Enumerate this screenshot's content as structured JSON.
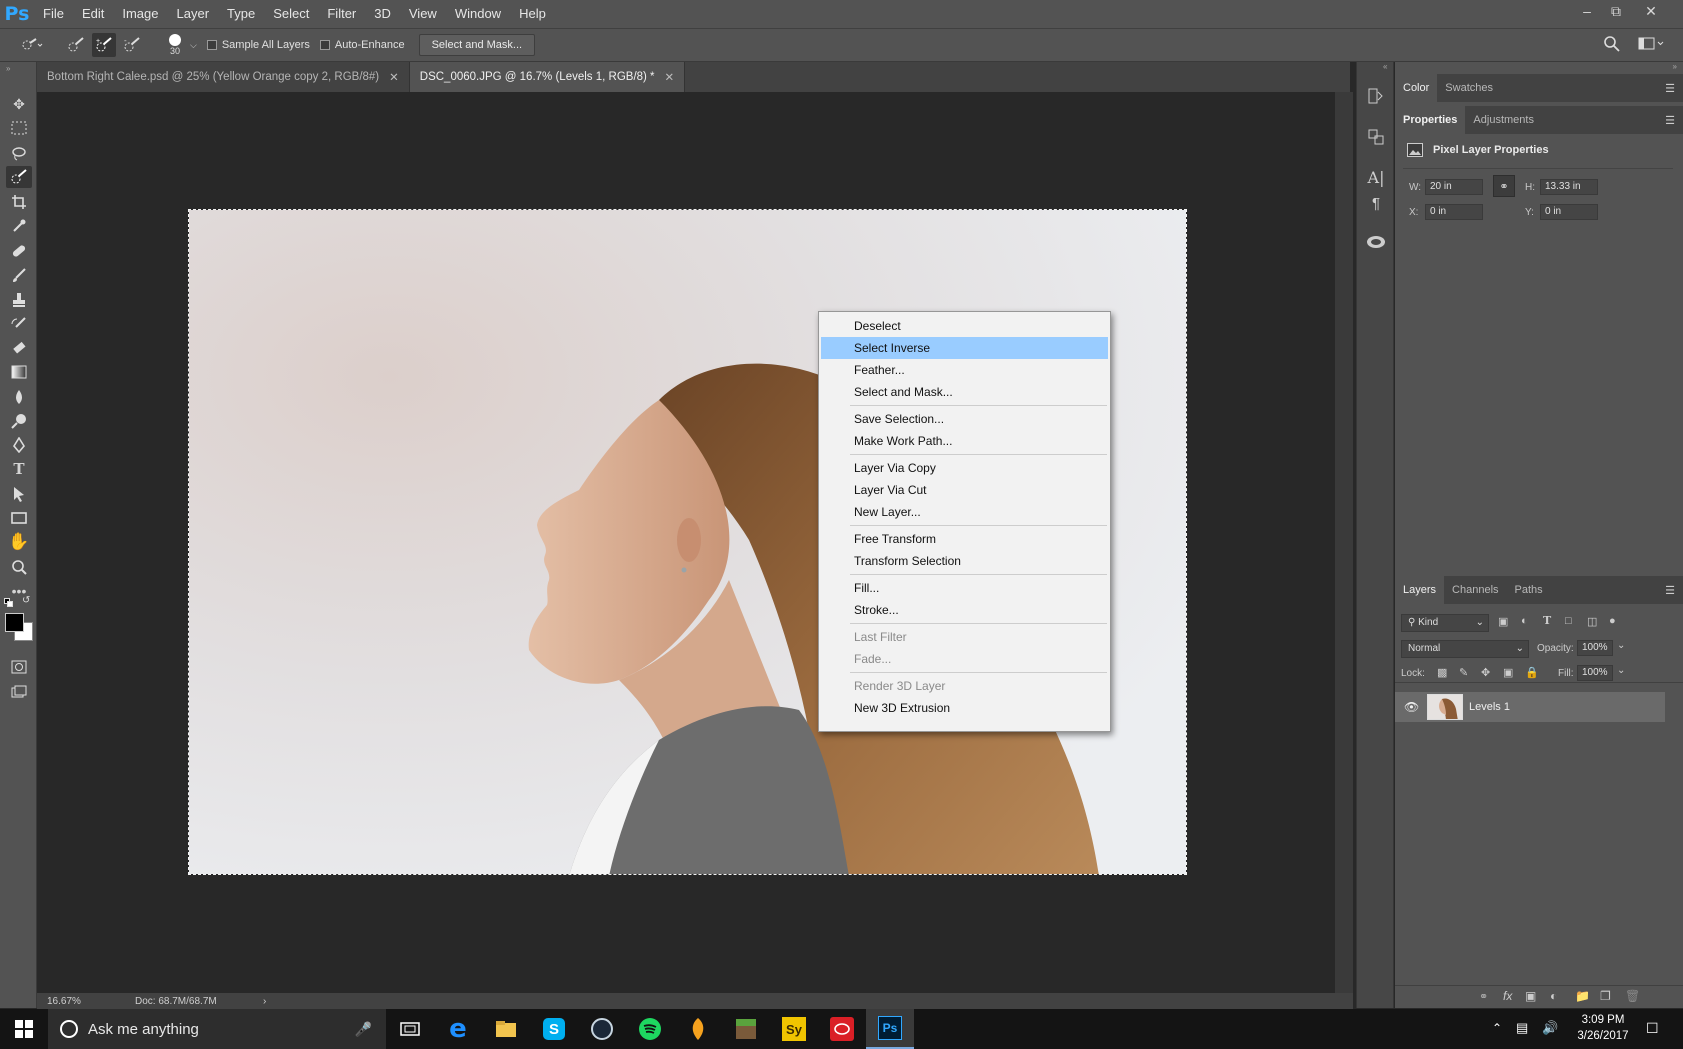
{
  "app": {
    "logo": "Ps"
  },
  "menubar": {
    "items": [
      "File",
      "Edit",
      "Image",
      "Layer",
      "Type",
      "Select",
      "Filter",
      "3D",
      "View",
      "Window",
      "Help"
    ]
  },
  "options": {
    "brush_size": "30",
    "sample_all_layers": "Sample All Layers",
    "auto_enhance": "Auto-Enhance",
    "select_and_mask": "Select and Mask..."
  },
  "tabs": [
    {
      "label": "Bottom Right Calee.psd @ 25% (Yellow Orange copy 2, RGB/8#)",
      "active": false
    },
    {
      "label": "DSC_0060.JPG @ 16.7% (Levels 1, RGB/8) *",
      "active": true
    }
  ],
  "context_menu": {
    "items": [
      {
        "label": "Deselect"
      },
      {
        "label": "Select Inverse",
        "highlighted": true
      },
      {
        "label": "Feather..."
      },
      {
        "label": "Select and Mask..."
      },
      {
        "sep": true
      },
      {
        "label": "Save Selection..."
      },
      {
        "label": "Make Work Path..."
      },
      {
        "sep": true
      },
      {
        "label": "Layer Via Copy"
      },
      {
        "label": "Layer Via Cut"
      },
      {
        "label": "New Layer..."
      },
      {
        "sep": true
      },
      {
        "label": "Free Transform"
      },
      {
        "label": "Transform Selection"
      },
      {
        "sep": true
      },
      {
        "label": "Fill..."
      },
      {
        "label": "Stroke..."
      },
      {
        "sep": true
      },
      {
        "label": "Last Filter",
        "disabled": true
      },
      {
        "label": "Fade...",
        "disabled": true
      },
      {
        "sep": true
      },
      {
        "label": "Render 3D Layer",
        "disabled": true
      },
      {
        "label": "New 3D Extrusion"
      }
    ]
  },
  "panels": {
    "color_tabs": [
      "Color",
      "Swatches"
    ],
    "properties_tabs": [
      "Properties",
      "Adjustments"
    ],
    "properties_title": "Pixel Layer Properties",
    "w_label": "W:",
    "w_value": "20 in",
    "h_label": "H:",
    "h_value": "13.33 in",
    "x_label": "X:",
    "x_value": "0 in",
    "y_label": "Y:",
    "y_value": "0 in",
    "layers_tabs": [
      "Layers",
      "Channels",
      "Paths"
    ],
    "kind": "Kind",
    "blend_mode": "Normal",
    "opacity_label": "Opacity:",
    "opacity_value": "100%",
    "lock_label": "Lock:",
    "fill_label": "Fill:",
    "fill_value": "100%",
    "layer_name": "Levels 1"
  },
  "status": {
    "zoom": "16.67%",
    "doc": "Doc: 68.7M/68.7M"
  },
  "taskbar": {
    "search_placeholder": "Ask me anything",
    "time": "3:09 PM",
    "date": "3/26/2017"
  },
  "colors": {
    "accent": "#31a8ff",
    "highlight": "#99ccff",
    "ui_bg": "#535353",
    "canvas_bg": "#282828"
  }
}
